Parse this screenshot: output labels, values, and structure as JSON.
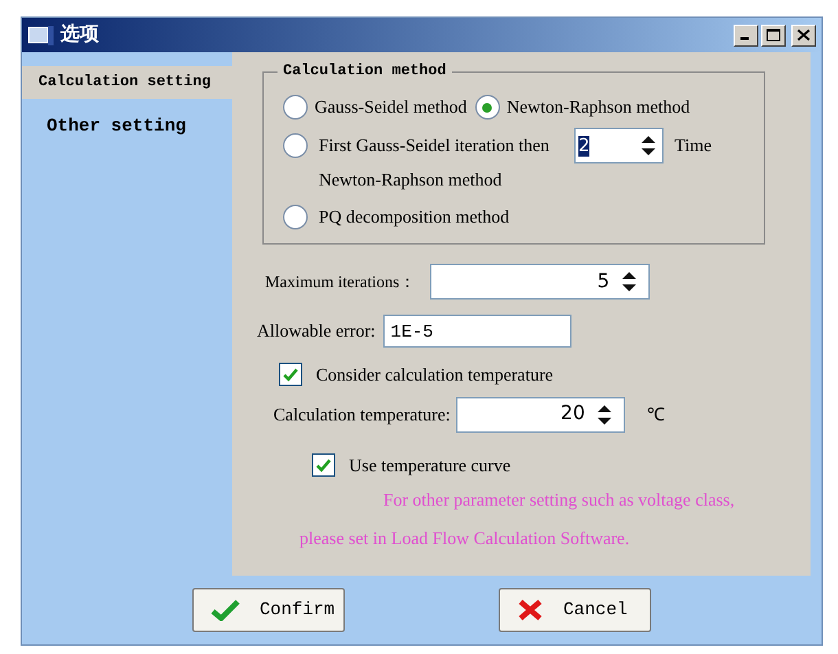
{
  "window": {
    "title": "选项"
  },
  "sidebar": {
    "items": [
      {
        "label": "Calculation setting",
        "selected": true
      },
      {
        "label": "Other setting",
        "selected": false
      }
    ]
  },
  "calculation_method": {
    "title": "Calculation method",
    "options": [
      {
        "kind": "plain",
        "label": "Gauss-Seidel method",
        "selected": false
      },
      {
        "kind": "plain",
        "label": "Newton-Raphson method",
        "selected": true
      },
      {
        "kind": "count",
        "label": "First Gauss-Seidel iteration then Newton-Raphson method",
        "selected": false,
        "count": "2",
        "unit": "Time"
      },
      {
        "kind": "plain",
        "label": "PQ decomposition method",
        "selected": false
      }
    ]
  },
  "max_iterations": {
    "label": "Maximum iterations：",
    "value": "5"
  },
  "allowable_error": {
    "label": "Allowable error:",
    "value": "1E-5"
  },
  "consider_temperature": {
    "label": "Consider calculation temperature",
    "checked": true
  },
  "calculation_temperature": {
    "label": "Calculation temperature:",
    "value": "20",
    "unit": "℃"
  },
  "use_temperature_curve": {
    "label": "Use temperature curve",
    "checked": true
  },
  "note": {
    "lines": [
      "For other parameter setting such as voltage class,",
      "please set in Load Flow Calculation Software."
    ]
  },
  "buttons": [
    {
      "kind": "confirm",
      "label": "Confirm"
    },
    {
      "kind": "cancel",
      "label": "Cancel"
    }
  ]
}
